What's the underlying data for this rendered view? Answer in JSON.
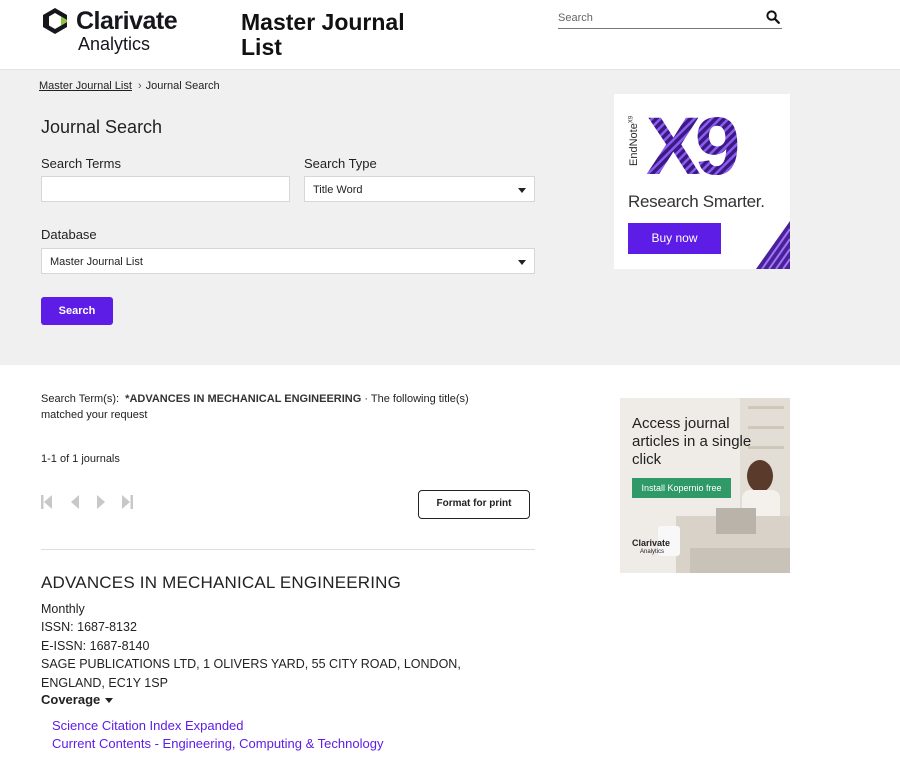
{
  "header": {
    "logo_line1": "Clarivate",
    "logo_line2": "Analytics",
    "site_title": "Master Journal List",
    "search_placeholder": "Search"
  },
  "breadcrumb": {
    "home": "Master Journal List",
    "current": "Journal Search"
  },
  "search_form": {
    "heading": "Journal Search",
    "terms_label": "Search Terms",
    "terms_value": "",
    "type_label": "Search Type",
    "type_value": "Title Word",
    "database_label": "Database",
    "database_value": "Master Journal List",
    "submit_label": "Search"
  },
  "ad_endnote": {
    "product": "EndNote",
    "version_sup": "X9",
    "big_text": "X9",
    "tagline": "Research Smarter.",
    "button": "Buy now"
  },
  "results": {
    "term_prefix": "Search Term(s):",
    "term_value": "*ADVANCES IN MECHANICAL ENGINEERING",
    "term_suffix": " · The following title(s) matched your request",
    "count_text": "1-1 of 1 journals",
    "print_button": "Format for print"
  },
  "journal": {
    "title": "ADVANCES IN MECHANICAL ENGINEERING",
    "frequency": "Monthly",
    "issn": "ISSN: 1687-8132",
    "eissn": "E-ISSN: 1687-8140",
    "publisher": "SAGE PUBLICATIONS LTD, 1 OLIVERS YARD, 55 CITY ROAD, LONDON, ENGLAND, EC1Y 1SP",
    "coverage_label": "Coverage",
    "coverage": [
      "Science Citation Index Expanded",
      "Current Contents - Engineering, Computing & Technology"
    ]
  },
  "ad_kopernio": {
    "text": "Access journal articles in a single click",
    "button": "Install Kopernio free",
    "logo_line1": "Clarivate",
    "logo_line2": "Analytics"
  },
  "colors": {
    "accent": "#5e1de6",
    "panel_bg": "#f0f0f0",
    "kopernio_green": "#2f9968"
  }
}
